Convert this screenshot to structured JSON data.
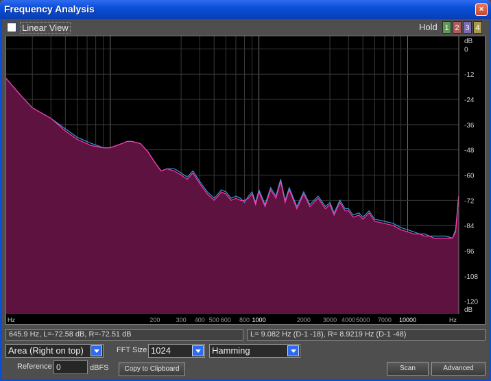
{
  "window": {
    "title": "Frequency Analysis",
    "close_glyph": "×"
  },
  "toolbar": {
    "linear_view_label": "Linear View",
    "linear_view_checked": false,
    "hold_label": "Hold",
    "hold_buttons": [
      {
        "label": "1",
        "color": "#5c9a52"
      },
      {
        "label": "2",
        "color": "#b05a5a"
      },
      {
        "label": "3",
        "color": "#7a6aae"
      },
      {
        "label": "4",
        "color": "#a89a4a"
      }
    ]
  },
  "plot": {
    "y_unit_top": "dB",
    "y_unit_bottom": "dB",
    "x_unit_left": "Hz",
    "x_unit_right": "Hz",
    "y_ticks": [
      "0",
      "-12",
      "-24",
      "-36",
      "-48",
      "-60",
      "-72",
      "-84",
      "-96",
      "-108",
      "-120"
    ],
    "x_ticks": [
      "200",
      "300",
      "400",
      "500",
      "600",
      "800",
      "1000",
      "2000",
      "3000",
      "4000",
      "5000",
      "7000",
      "10000"
    ],
    "colors": {
      "fill": "#5e1240",
      "left_line": "#3a9ae0",
      "right_line": "#ff3aa8",
      "grid_major": "#777777",
      "grid_minor": "#3a3a3a"
    }
  },
  "chart_data": {
    "type": "area",
    "x_scale": "log",
    "xlim": [
      20,
      22050
    ],
    "ylim": [
      -126,
      6
    ],
    "grid": true,
    "series": [
      {
        "x": [
          20,
          25,
          30,
          40,
          50,
          60,
          75,
          90,
          100,
          110,
          120,
          130,
          140,
          160,
          180,
          200,
          220,
          240,
          270,
          300,
          330,
          360,
          400,
          450,
          500,
          530,
          560,
          600,
          650,
          700,
          750,
          800,
          850,
          900,
          950,
          1000,
          1100,
          1200,
          1300,
          1400,
          1500,
          1600,
          1800,
          2000,
          2200,
          2500,
          2800,
          3000,
          3200,
          3500,
          3800,
          4000,
          4300,
          4700,
          5000,
          5500,
          6000,
          7000,
          8000,
          9000,
          10000,
          11000,
          12000,
          13000,
          14000,
          15000,
          16000,
          18000,
          20000,
          21000,
          22000
        ],
        "values": [
          -14,
          -22,
          -28,
          -33,
          -38,
          -42,
          -45,
          -47,
          -47,
          -46,
          -45,
          -44,
          -44,
          -45,
          -49,
          -54,
          -58,
          -57,
          -57,
          -59,
          -61,
          -58,
          -63,
          -68,
          -71,
          -69,
          -67,
          -68,
          -71,
          -70,
          -71,
          -73,
          -70,
          -68,
          -73,
          -67,
          -74,
          -66,
          -70,
          -62,
          -72,
          -66,
          -75,
          -68,
          -74,
          -70,
          -75,
          -73,
          -78,
          -72,
          -76,
          -76,
          -79,
          -78,
          -80,
          -77,
          -81,
          -82,
          -83,
          -85,
          -86,
          -87,
          -88,
          -88,
          -89,
          -89,
          -89,
          -89,
          -90,
          -86,
          -70
        ]
      },
      {
        "x": [
          20,
          25,
          30,
          40,
          50,
          60,
          75,
          90,
          100,
          110,
          120,
          130,
          140,
          160,
          180,
          200,
          220,
          240,
          270,
          300,
          330,
          360,
          400,
          450,
          500,
          530,
          560,
          600,
          650,
          700,
          750,
          800,
          850,
          900,
          950,
          1000,
          1100,
          1200,
          1300,
          1400,
          1500,
          1600,
          1800,
          2000,
          2200,
          2500,
          2800,
          3000,
          3200,
          3500,
          3800,
          4000,
          4300,
          4700,
          5000,
          5500,
          6000,
          7000,
          8000,
          9000,
          10000,
          11000,
          12000,
          13000,
          14000,
          15000,
          16000,
          18000,
          20000,
          21000,
          22000
        ],
        "values": [
          -14,
          -22,
          -28,
          -33,
          -39,
          -43,
          -46,
          -47,
          -47,
          -46,
          -45,
          -44,
          -44,
          -45,
          -49,
          -54,
          -58,
          -57,
          -58,
          -60,
          -62,
          -59,
          -64,
          -69,
          -72,
          -70,
          -68,
          -69,
          -72,
          -71,
          -72,
          -72,
          -71,
          -69,
          -74,
          -68,
          -75,
          -67,
          -71,
          -63,
          -73,
          -67,
          -76,
          -69,
          -75,
          -71,
          -76,
          -74,
          -79,
          -73,
          -77,
          -77,
          -80,
          -79,
          -81,
          -78,
          -82,
          -83,
          -84,
          -86,
          -87,
          -88,
          -88,
          -89,
          -89,
          -90,
          -90,
          -90,
          -90,
          -87,
          -70
        ]
      }
    ]
  },
  "status": {
    "cursor": "645.9 Hz, L=-72.58 dB, R=-72.51 dB",
    "peak": "L=  9.082 Hz (D-1 -18), R= 8.9219 Hz (D-1 -48)"
  },
  "controls": {
    "graph_style": "Area (Right on top)",
    "fft_size_label": "FFT Size",
    "fft_size": "1024",
    "window_func": "Hamming",
    "reference_label": "Reference",
    "reference_value": "0",
    "reference_unit": "dBFS",
    "copy_button": "Copy to Clipboard",
    "scan_button": "Scan",
    "advanced_button": "Advanced"
  }
}
